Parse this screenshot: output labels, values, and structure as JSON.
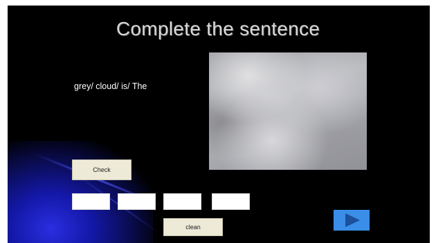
{
  "slide": {
    "title": "Complete the sentence",
    "scrambled_words": "grey/ cloud/ is/ The"
  },
  "buttons": {
    "check_label": "Check",
    "clean_label": "clean",
    "next_icon": "play-right-triangle"
  },
  "answer_slots": [
    "",
    "",
    "",
    ""
  ],
  "image": {
    "subject": "cloudy grey sky"
  },
  "colors": {
    "background": "#000000",
    "button": "#eeead8",
    "next_button": "#3a8ee8",
    "next_arrow": "#1c4f9c",
    "title_text": "#d8d8d8"
  }
}
